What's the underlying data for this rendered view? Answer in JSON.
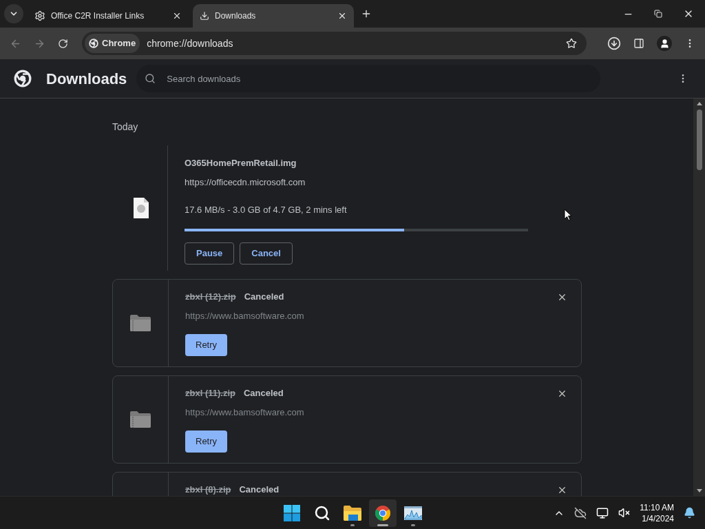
{
  "tabs": [
    {
      "title": "Office C2R Installer Links",
      "kind": "page",
      "selected": false
    },
    {
      "title": "Downloads",
      "kind": "downloads",
      "selected": true
    }
  ],
  "toolbar": {
    "site_chip": "Chrome",
    "address": "chrome://downloads"
  },
  "header": {
    "title": "Downloads",
    "search": {
      "placeholder": "Search downloads"
    }
  },
  "section": "Today",
  "downloads": [
    {
      "kind": "active",
      "name": "O365HomePremRetail.img",
      "url": "https://officecdn.microsoft.com",
      "status": "17.6 MB/s - 3.0 GB of 4.7 GB, 2 mins left",
      "level": 0.64,
      "buttons": [
        "Pause",
        "Cancel"
      ]
    },
    {
      "kind": "canceled",
      "name": "zbxl (12).zip",
      "status": "Canceled",
      "url": "https://www.bamsoftware.com",
      "buttons": [
        "Retry"
      ]
    },
    {
      "kind": "canceled",
      "name": "zbxl (11).zip",
      "status": "Canceled",
      "url": "https://www.bamsoftware.com",
      "buttons": [
        "Retry"
      ]
    },
    {
      "kind": "canceled",
      "name": "zbxl (8).zip",
      "status": "Canceled"
    }
  ],
  "taskbar": {
    "apps": [
      {
        "kind": "start",
        "running": false,
        "selected": false
      },
      {
        "kind": "search",
        "running": false,
        "selected": false
      },
      {
        "kind": "explorer",
        "running": true,
        "selected": false
      },
      {
        "kind": "browser",
        "running": true,
        "selected": true
      },
      {
        "kind": "monitor",
        "running": true,
        "selected": false
      }
    ],
    "time": "11:10 AM",
    "date": "1/4/2024"
  }
}
